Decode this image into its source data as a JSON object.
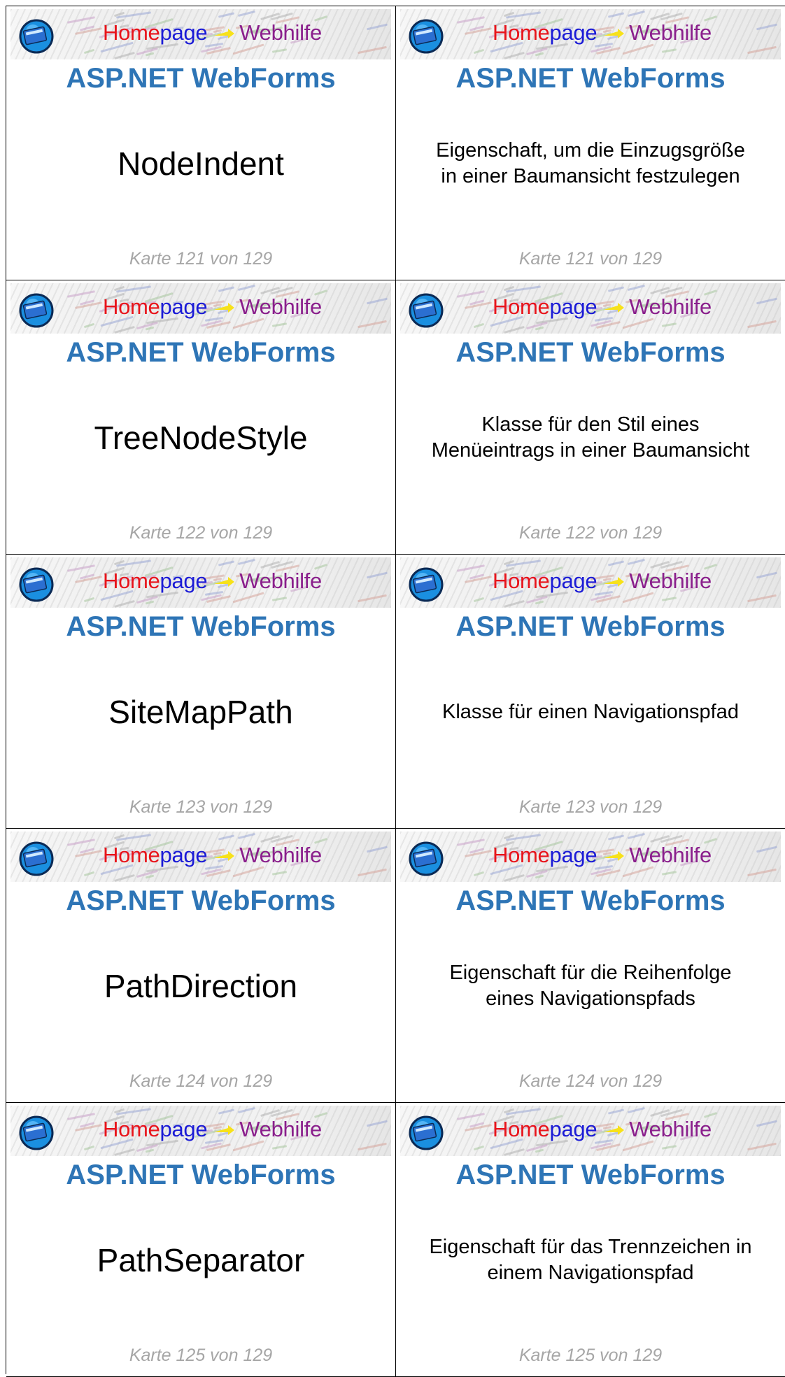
{
  "banner": {
    "home_part1": "Home",
    "home_part2": "page",
    "webhilfe": "Webhilfe",
    "logo_icon": "homepage-logo-icon",
    "arrow_icon": "yellow-arrow-icon"
  },
  "colors": {
    "topic": "#2e75b6",
    "footer": "#a6a6a6",
    "home_red": "#e8141b",
    "page_blue": "#1b1bd6",
    "webhilfe_purple": "#8a1f8c"
  },
  "cards": [
    {
      "topic": "ASP.NET WebForms",
      "front": "NodeIndent",
      "back_line1": "Eigenschaft, um die Einzugsgröße",
      "back_line2": "in einer Baumansicht festzulegen",
      "footer": "Karte 121 von 129"
    },
    {
      "topic": "ASP.NET WebForms",
      "front": "TreeNodeStyle",
      "back_line1": "Klasse für den Stil eines",
      "back_line2": "Menüeintrags in einer Baumansicht",
      "footer": "Karte 122 von 129"
    },
    {
      "topic": "ASP.NET WebForms",
      "front": "SiteMapPath",
      "back_line1": "Klasse für einen Navigationspfad",
      "back_line2": "",
      "footer": "Karte 123 von 129"
    },
    {
      "topic": "ASP.NET WebForms",
      "front": "PathDirection",
      "back_line1": "Eigenschaft für die Reihenfolge",
      "back_line2": "eines Navigationspfads",
      "footer": "Karte 124 von 129"
    },
    {
      "topic": "ASP.NET WebForms",
      "front": "PathSeparator",
      "back_line1": "Eigenschaft für das Trennzeichen in",
      "back_line2": "einem Navigationspfad",
      "footer": "Karte 125 von 129"
    }
  ]
}
